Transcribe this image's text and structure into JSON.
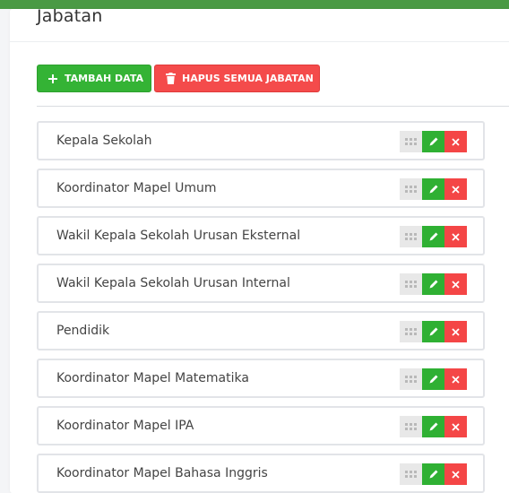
{
  "page": {
    "title": "Jabatan"
  },
  "toolbar": {
    "add_label": "TAMBAH DATA",
    "delete_all_label": "HAPUS SEMUA JABATAN"
  },
  "jabatan": [
    "Kepala Sekolah",
    "Koordinator Mapel Umum",
    "Wakil Kepala Sekolah Urusan Eksternal",
    "Wakil Kepala Sekolah Urusan Internal",
    "Pendidik",
    "Koordinator Mapel Matematika",
    "Koordinator Mapel IPA",
    "Koordinator Mapel Bahasa Inggris"
  ],
  "row_actions": {
    "icons": [
      "drag-handle-icon",
      "pencil-icon",
      "close-icon"
    ]
  },
  "colors": {
    "header_green": "#4a9a44",
    "add_button": "#34b335",
    "delete_button": "#f44b4b",
    "edit_action": "#2fb033",
    "delete_action": "#f44646"
  }
}
